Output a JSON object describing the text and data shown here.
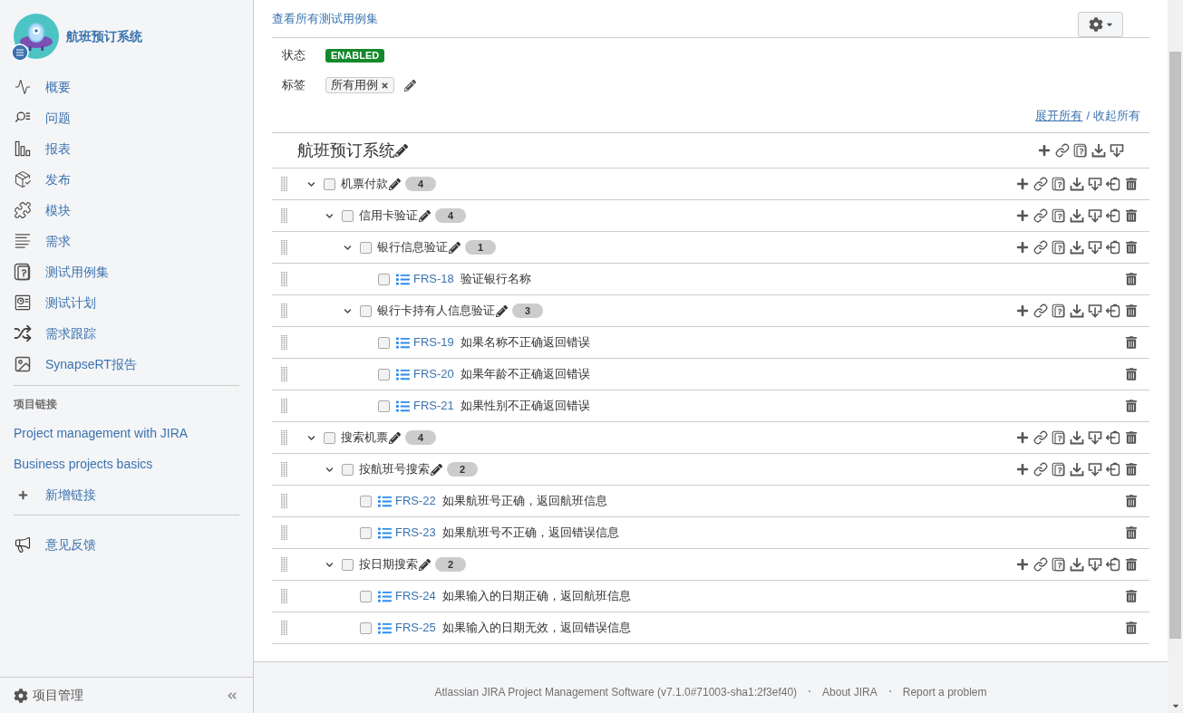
{
  "sidebar": {
    "project_name": "航班预订系统",
    "nav_items": [
      "概要",
      "问题",
      "报表",
      "发布",
      "模块",
      "需求",
      "测试用例集",
      "测试计划",
      "需求跟踪",
      "SynapseRT报告"
    ],
    "links_heading": "项目链接",
    "links": [
      "Project management with JIRA",
      "Business projects basics"
    ],
    "add_link": "新增链接",
    "feedback": "意见反馈",
    "admin": "项目管理"
  },
  "main": {
    "view_all_link": "查看所有测试用例集",
    "status_label": "状态",
    "status_value": "ENABLED",
    "labels_label": "标签",
    "labels": [
      "所有用例"
    ],
    "expand_links": [
      {
        "label": "展开所有",
        "hovered": true
      },
      {
        "label": "收起所有",
        "hovered": false
      }
    ],
    "separator": "/",
    "tree": {
      "title": "航班预订系统",
      "children": [
        {
          "kind": "folder",
          "name": "机票付款",
          "count": "4",
          "expanded": true,
          "checked": false,
          "children": [
            {
              "kind": "folder",
              "name": "信用卡验证",
              "count": "4",
              "expanded": true,
              "checked": false,
              "children": [
                {
                  "kind": "folder",
                  "name": "银行信息验证",
                  "count": "1",
                  "expanded": true,
                  "checked": false,
                  "children": [
                    {
                      "kind": "case",
                      "key": "FRS-18",
                      "title": "验证银行名称",
                      "checked": false
                    }
                  ]
                },
                {
                  "kind": "folder",
                  "name": "银行卡持有人信息验证",
                  "count": "3",
                  "expanded": true,
                  "checked": false,
                  "children": [
                    {
                      "kind": "case",
                      "key": "FRS-19",
                      "title": "如果名称不正确返回错误",
                      "checked": false
                    },
                    {
                      "kind": "case",
                      "key": "FRS-20",
                      "title": "如果年龄不正确返回错误",
                      "checked": false
                    },
                    {
                      "kind": "case",
                      "key": "FRS-21",
                      "title": "如果性别不正确返回错误",
                      "checked": false
                    }
                  ]
                }
              ]
            }
          ]
        },
        {
          "kind": "folder",
          "name": "搜索机票",
          "count": "4",
          "expanded": true,
          "checked": false,
          "children": [
            {
              "kind": "folder",
              "name": "按航班号搜索",
              "count": "2",
              "expanded": true,
              "checked": false,
              "children": [
                {
                  "kind": "case",
                  "key": "FRS-22",
                  "title": "如果航班号正确，返回航班信息",
                  "checked": false
                },
                {
                  "kind": "case",
                  "key": "FRS-23",
                  "title": "如果航班号不正确，返回错误信息",
                  "checked": false
                }
              ]
            },
            {
              "kind": "folder",
              "name": "按日期搜索",
              "count": "2",
              "expanded": true,
              "checked": false,
              "children": [
                {
                  "kind": "case",
                  "key": "FRS-24",
                  "title": "如果输入的日期正确，返回航班信息",
                  "checked": false
                },
                {
                  "kind": "case",
                  "key": "FRS-25",
                  "title": "如果输入的日期无效，返回错误信息",
                  "checked": false
                }
              ]
            }
          ]
        }
      ]
    }
  },
  "footer": {
    "items": [
      "Atlassian JIRA Project Management Software (v7.1.0#71003-sha1:2f3ef40)",
      "About JIRA",
      "Report a problem"
    ]
  }
}
